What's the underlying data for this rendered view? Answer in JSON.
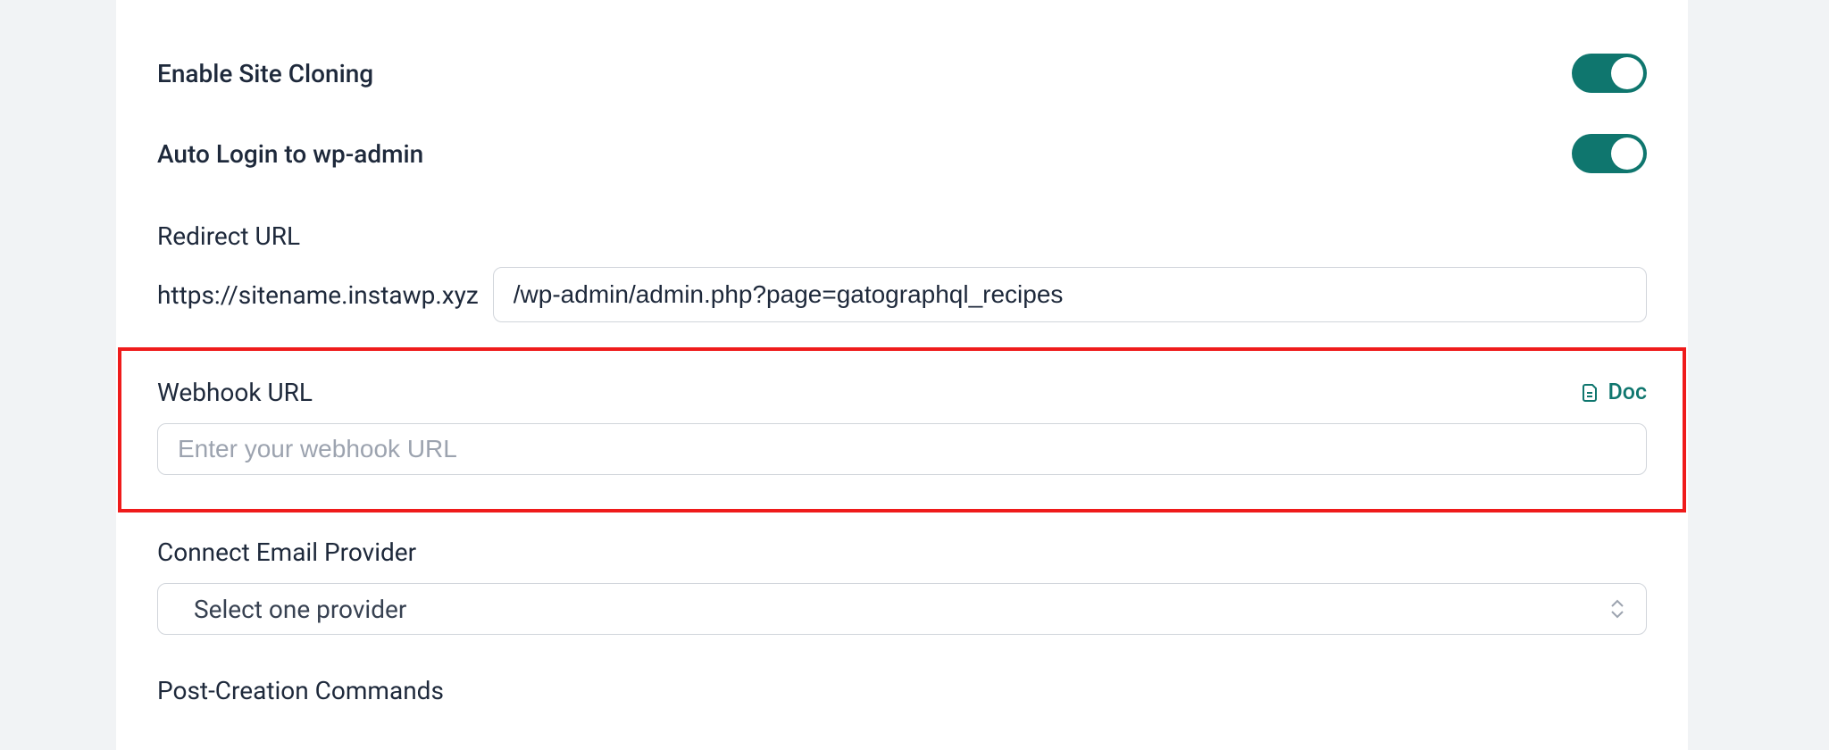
{
  "settings": {
    "enable_site_cloning": {
      "label": "Enable Site Cloning",
      "value": true
    },
    "auto_login": {
      "label": "Auto Login to wp-admin",
      "value": true
    },
    "redirect_url": {
      "label": "Redirect URL",
      "prefix": "https://sitename.instawp.xyz",
      "value": "/wp-admin/admin.php?page=gatographql_recipes"
    },
    "webhook_url": {
      "label": "Webhook URL",
      "doc_label": "Doc",
      "placeholder": "Enter your webhook URL",
      "value": ""
    },
    "email_provider": {
      "label": "Connect Email Provider",
      "selected_label": "Select one provider"
    },
    "post_creation": {
      "label": "Post-Creation Commands"
    }
  },
  "colors": {
    "accent": "#0f766e",
    "highlight_border": "#ef1b1b"
  }
}
